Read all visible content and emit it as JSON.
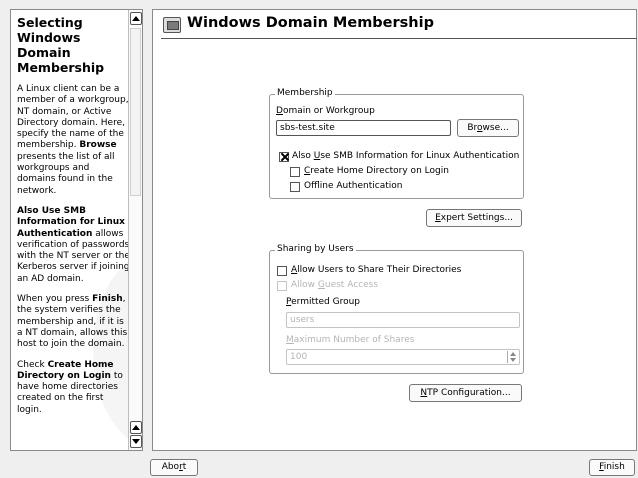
{
  "help": {
    "title": "Selecting Windows Domain Membership",
    "p1": "A Linux client can be a member of a workgroup, NT domain, or Active Directory domain. Here, specify the name of the membership.",
    "p1_bold": "Browse",
    "p1_tail": "presents the list of all workgroups and domains found in the network.",
    "p2_bold": "Also Use SMB Information for Linux Authentication",
    "p2_tail": "allows verification of passwords with the NT server or the Kerberos server if joining an AD domain.",
    "p3_head": "When you press",
    "p3_bold": "Finish",
    "p3_tail": ", the system verifies the membership and, if it is a NT domain, allows this host to join the domain.",
    "p4_head": "Check",
    "p4_bold": "Create Home Directory on Login",
    "p4_tail": "to have home directories created on the first login."
  },
  "main": {
    "title": "Windows Domain Membership",
    "membership": {
      "legend": "Membership",
      "domain_label_pre": "",
      "domain_label_u": "D",
      "domain_label_post": "omain or Workgroup",
      "domain_value": "sbs-test.site",
      "browse_pre": "Br",
      "browse_u": "o",
      "browse_post": "wse...",
      "smb_pre": "Also ",
      "smb_u": "U",
      "smb_post": "se SMB Information for Linux Authentication",
      "home_pre": "",
      "home_u": "C",
      "home_post": "reate Home Directory on Login",
      "offline_pre": "Off",
      "offline_u": "l",
      "offline_post": "ine Authentication"
    },
    "expert_pre": "",
    "expert_u": "E",
    "expert_post": "xpert Settings...",
    "sharing": {
      "legend": "Sharing by Users",
      "allow_pre": "",
      "allow_u": "A",
      "allow_post": "llow Users to Share Their Directories",
      "guest_pre": "Allow ",
      "guest_u": "G",
      "guest_post": "uest Access",
      "group_pre": "",
      "group_u": "P",
      "group_post": "ermitted Group",
      "group_value": "users",
      "max_pre": "",
      "max_u": "M",
      "max_post": "aximum Number of Shares",
      "max_value": "100"
    },
    "ntp_pre": "",
    "ntp_u": "N",
    "ntp_post": "TP Configuration..."
  },
  "footer": {
    "abort_pre": "Abo",
    "abort_u": "r",
    "abort_post": "t",
    "finish_pre": "",
    "finish_u": "F",
    "finish_post": "inish"
  },
  "state": {
    "smb_checked": true,
    "home_checked": false,
    "offline_checked": false,
    "allow_users_checked": false,
    "guest_checked": false
  }
}
